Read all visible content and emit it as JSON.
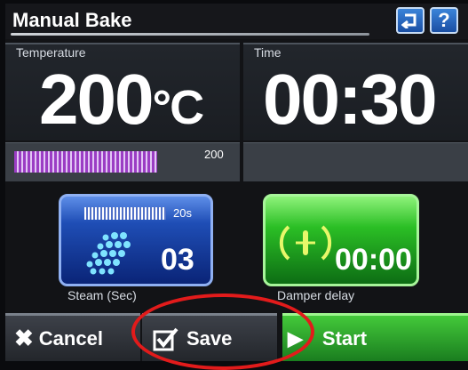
{
  "header": {
    "title": "Manual Bake",
    "back_icon_glyph": "↰",
    "help_label": "?"
  },
  "temperature": {
    "label": "Temperature",
    "value": "200",
    "unit": "°C",
    "setpoint_label": "200",
    "bar_fill_fraction": 0.78,
    "bar_color": "#9b3dc4"
  },
  "time": {
    "label": "Time",
    "value": "00:30"
  },
  "steam": {
    "timer_label": "20s",
    "value": "03",
    "caption": "Steam (Sec)"
  },
  "damper": {
    "value": "00:00",
    "caption": "Damper delay"
  },
  "actions": {
    "cancel_label": "Cancel",
    "save_label": "Save",
    "start_label": "Start"
  },
  "colors": {
    "accent_blue": "#1f4eb6",
    "accent_green": "#2bbf25",
    "highlight_red": "#e21b1b"
  }
}
